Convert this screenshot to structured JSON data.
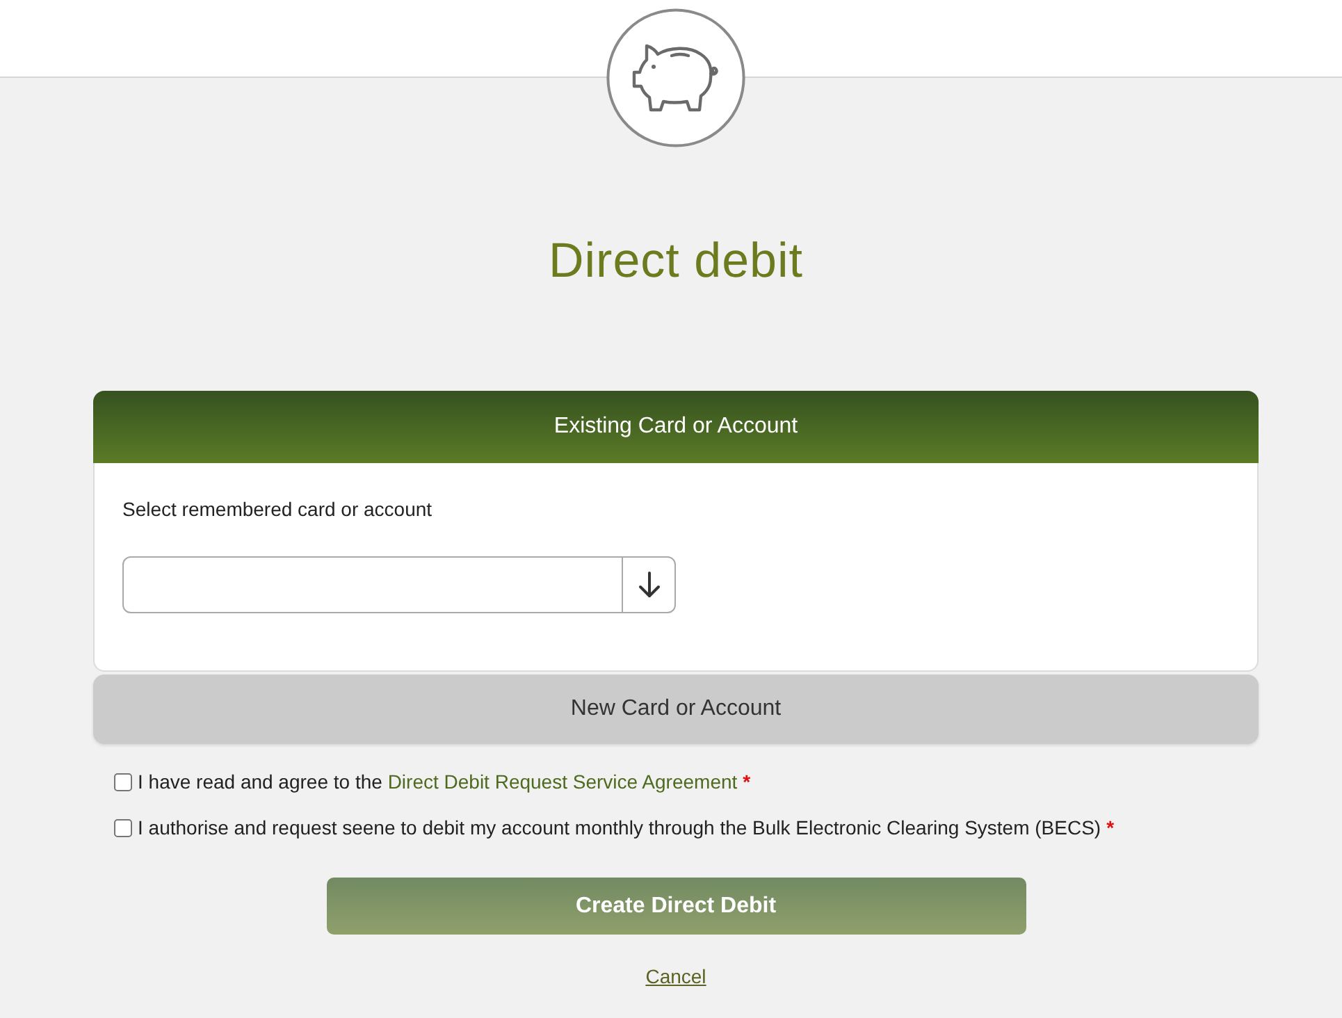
{
  "title": "Direct debit",
  "panels": [
    {
      "heading": "Existing Card or Account",
      "expanded": true,
      "field": {
        "label": "Select remembered card or account"
      }
    },
    {
      "heading": "New Card or Account",
      "expanded": false
    }
  ],
  "agreements": [
    {
      "text": "I have read and agree to the",
      "link": "Direct Debit Request Service Agreement",
      "required_mark": "*",
      "checked": false
    },
    {
      "text": "I authorise and request seene to debit my account monthly through the Bulk Electronic Clearing System (BECS)",
      "required_mark": "*",
      "checked": false
    }
  ],
  "actions": {
    "submit": "Create Direct Debit",
    "cancel": "Cancel"
  }
}
